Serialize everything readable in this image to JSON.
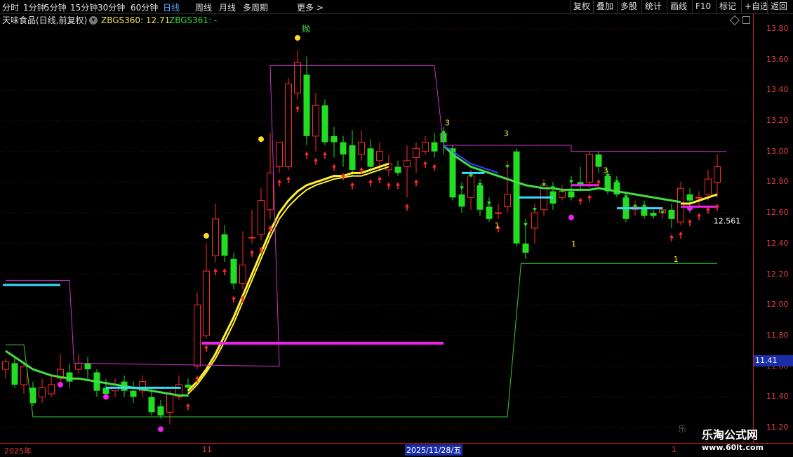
{
  "toolbar": {
    "left_items": [
      "分时",
      "1分钟",
      "5分钟",
      "15分钟",
      "30分钟",
      "60分钟",
      "日线",
      "周线",
      "月线",
      "多周期",
      "更多 >"
    ],
    "active": "日线",
    "right_items": [
      "复权",
      "叠加",
      "多股",
      "统计",
      "画线",
      "F10",
      "标记",
      "+自选",
      "返回"
    ]
  },
  "info": {
    "stock": "天味食品(日线,前复权)",
    "settings_icon": "gear-icon",
    "ind1": "ZBGS360: 12.71",
    "ind2": "ZBGS361: -"
  },
  "yaxis": {
    "labels": [
      "13.80",
      "13.60",
      "13.40",
      "13.20",
      "13.00",
      "12.80",
      "12.60",
      "12.40",
      "12.20",
      "12.00",
      "11.80",
      "11.60",
      "11.40",
      "11.20"
    ],
    "current_price": "11.41"
  },
  "xaxis": {
    "labels": [
      "2025年",
      "11",
      "1"
    ],
    "cursor_date": "2025/11/28/五"
  },
  "annotations": {
    "throw": "抛",
    "three_a": "3",
    "three_b": "3",
    "three_c": "3",
    "one_a": "1",
    "one_b": "1",
    "one_c": "1",
    "last_value": "12.561"
  },
  "watermark": {
    "name": "乐淘公式网",
    "url": "www.60lt.com",
    "small": "乐"
  },
  "colors": {
    "up": "#ff2a2a",
    "down": "#22dd22",
    "ma_yellow": "#ffee33",
    "ma_green": "#44dd44",
    "cyan": "#33ddff",
    "magenta": "#ee22ee",
    "axis": "#c02020"
  },
  "chart_data": {
    "type": "candlestick",
    "y_range": [
      11.1,
      13.9
    ],
    "candles": [
      [
        11.58,
        11.63,
        11.52,
        11.65
      ],
      [
        11.62,
        11.48,
        11.46,
        11.66
      ],
      [
        11.48,
        11.6,
        11.42,
        11.62
      ],
      [
        11.46,
        11.36,
        11.34,
        11.5
      ],
      [
        11.4,
        11.46,
        11.36,
        11.52
      ],
      [
        11.42,
        11.48,
        11.4,
        11.54
      ],
      [
        11.52,
        11.58,
        11.48,
        11.68
      ],
      [
        11.56,
        11.5,
        11.46,
        11.62
      ],
      [
        11.58,
        11.62,
        11.55,
        11.68
      ],
      [
        11.62,
        11.58,
        11.52,
        11.66
      ],
      [
        11.56,
        11.44,
        11.4,
        11.58
      ],
      [
        11.46,
        11.42,
        11.4,
        11.52
      ],
      [
        11.44,
        11.48,
        11.4,
        11.52
      ],
      [
        11.5,
        11.44,
        11.4,
        11.54
      ],
      [
        11.44,
        11.4,
        11.36,
        11.5
      ],
      [
        11.44,
        11.5,
        11.4,
        11.54
      ],
      [
        11.4,
        11.3,
        11.28,
        11.46
      ],
      [
        11.34,
        11.28,
        11.26,
        11.38
      ],
      [
        11.3,
        11.42,
        11.22,
        11.44
      ],
      [
        11.4,
        11.48,
        11.38,
        11.54
      ],
      [
        11.48,
        11.46,
        11.4,
        11.52
      ],
      [
        11.6,
        12.0,
        11.58,
        12.08
      ],
      [
        11.8,
        12.22,
        11.78,
        12.4
      ],
      [
        12.32,
        12.56,
        12.28,
        12.66
      ],
      [
        12.46,
        12.32,
        12.28,
        12.52
      ],
      [
        12.3,
        12.14,
        12.1,
        12.34
      ],
      [
        12.14,
        12.26,
        12.1,
        12.48
      ],
      [
        12.44,
        12.44,
        12.4,
        12.62
      ],
      [
        12.46,
        12.68,
        12.42,
        12.76
      ],
      [
        12.62,
        12.86,
        12.56,
        13.12
      ],
      [
        12.9,
        13.06,
        12.86,
        13.06
      ],
      [
        12.9,
        13.44,
        12.88,
        13.48
      ],
      [
        13.38,
        13.58,
        13.34,
        13.66
      ],
      [
        13.5,
        13.1,
        13.04,
        13.62
      ],
      [
        13.1,
        13.3,
        13.0,
        13.38
      ],
      [
        13.3,
        13.06,
        13.04,
        13.34
      ],
      [
        13.1,
        13.06,
        12.96,
        13.16
      ],
      [
        13.06,
        12.98,
        12.9,
        13.1
      ],
      [
        13.04,
        12.88,
        12.84,
        13.14
      ],
      [
        12.98,
        13.06,
        12.94,
        13.14
      ],
      [
        13.02,
        12.9,
        12.86,
        13.08
      ],
      [
        12.94,
        13.0,
        12.88,
        13.06
      ],
      [
        12.88,
        12.92,
        12.84,
        12.98
      ],
      [
        12.9,
        12.86,
        12.84,
        12.94
      ],
      [
        12.9,
        12.94,
        12.7,
        13.04
      ],
      [
        12.96,
        13.02,
        12.86,
        13.06
      ],
      [
        13.0,
        13.06,
        12.98,
        13.1
      ],
      [
        13.06,
        13.0,
        12.96,
        13.12
      ],
      [
        13.12,
        13.06,
        12.98,
        13.16
      ],
      [
        13.02,
        12.7,
        12.68,
        13.04
      ],
      [
        12.72,
        12.64,
        12.6,
        12.8
      ],
      [
        12.7,
        12.84,
        12.62,
        12.88
      ],
      [
        12.78,
        12.62,
        12.58,
        12.82
      ],
      [
        12.64,
        12.56,
        12.54,
        12.7
      ],
      [
        12.6,
        12.6,
        12.56,
        12.66
      ],
      [
        12.64,
        12.72,
        12.6,
        12.94
      ],
      [
        13.0,
        12.4,
        12.38,
        13.02
      ],
      [
        12.4,
        12.34,
        12.3,
        12.56
      ],
      [
        12.5,
        12.6,
        12.4,
        12.66
      ],
      [
        12.62,
        12.78,
        12.58,
        12.82
      ],
      [
        12.74,
        12.66,
        12.62,
        12.8
      ],
      [
        12.7,
        12.74,
        12.68,
        12.78
      ],
      [
        12.74,
        12.7,
        12.68,
        12.84
      ],
      [
        12.8,
        12.78,
        12.74,
        12.9
      ],
      [
        12.8,
        12.98,
        12.76,
        13.0
      ],
      [
        12.98,
        12.9,
        12.86,
        13.0
      ],
      [
        12.84,
        12.74,
        12.72,
        12.88
      ],
      [
        12.8,
        12.72,
        12.7,
        12.84
      ],
      [
        12.7,
        12.56,
        12.54,
        12.74
      ],
      [
        12.62,
        12.64,
        12.58,
        12.68
      ],
      [
        12.64,
        12.58,
        12.56,
        12.68
      ],
      [
        12.6,
        12.58,
        12.56,
        12.62
      ],
      [
        12.6,
        12.62,
        12.56,
        12.64
      ],
      [
        12.62,
        12.56,
        12.5,
        12.66
      ],
      [
        12.54,
        12.76,
        12.52,
        12.8
      ],
      [
        12.72,
        12.68,
        12.6,
        12.76
      ],
      [
        12.7,
        12.7,
        12.64,
        12.74
      ],
      [
        12.72,
        12.82,
        12.68,
        12.88
      ],
      [
        12.8,
        12.9,
        12.7,
        12.98
      ]
    ],
    "ma_yellow_start": 20,
    "ma_yellow": [
      11.44,
      11.5,
      11.58,
      11.68,
      11.8,
      11.92,
      12.06,
      12.2,
      12.34,
      12.48,
      12.6,
      12.68,
      12.74,
      12.78,
      12.8,
      12.82,
      12.84,
      12.84,
      12.86,
      12.86,
      12.88,
      12.9,
      12.92
    ],
    "ma_yellow2_start": 20,
    "ma_yellow2": [
      11.42,
      11.48,
      11.56,
      11.65,
      11.76,
      11.88,
      12.02,
      12.16,
      12.3,
      12.44,
      12.56,
      12.64,
      12.7,
      12.75,
      12.78,
      12.8,
      12.82,
      12.83,
      12.84,
      12.84,
      12.86,
      12.88,
      12.9
    ],
    "ma_yellow3_start": 74,
    "ma_yellow3": [
      12.66,
      12.66,
      12.68,
      12.7,
      12.72
    ],
    "ma_green_a": [
      11.7,
      11.66,
      11.62,
      11.58,
      11.56,
      11.54,
      11.53,
      11.52,
      11.52,
      11.51,
      11.5,
      11.49,
      11.48,
      11.47,
      11.46,
      11.45,
      11.44,
      11.43,
      11.42,
      11.41,
      11.41
    ],
    "ma_green_b_start": 48,
    "ma_green_b": [
      13.04,
      12.98,
      12.94,
      12.9,
      12.88,
      12.86,
      12.84,
      12.82,
      12.8,
      12.78,
      12.77,
      12.76,
      12.76,
      12.75,
      12.75,
      12.75,
      12.75,
      12.76,
      12.75,
      12.74,
      12.73,
      12.72,
      12.71,
      12.7,
      12.69,
      12.68,
      12.67
    ],
    "blue_segment_start": 48,
    "blue_segment": [
      13.04,
      13.0,
      12.96,
      12.92,
      12.9,
      12.88,
      12.86
    ]
  }
}
